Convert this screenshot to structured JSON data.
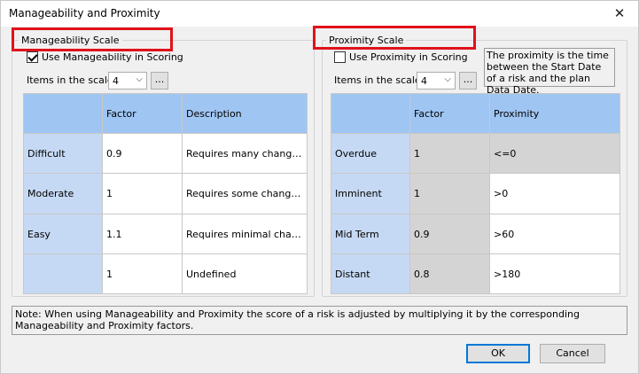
{
  "window": {
    "title": "Manageability and Proximity",
    "close_glyph": "✕"
  },
  "manageability": {
    "legend": "Manageability Scale",
    "use_label": "Use Manageability in Scoring",
    "use_checked": true,
    "items_label": "Items in the scale",
    "items_value": "4",
    "dots": "...",
    "headers": [
      "",
      "Factor",
      "Description"
    ],
    "rows": [
      {
        "name": "Difficult",
        "factor": "0.9",
        "description": "Requires many change..."
      },
      {
        "name": "Moderate",
        "factor": "1",
        "description": "Requires some changes..."
      },
      {
        "name": "Easy",
        "factor": "1.1",
        "description": "Requires minimal chan..."
      },
      {
        "name": "",
        "factor": "1",
        "description": "Undefined"
      }
    ]
  },
  "proximity": {
    "legend": "Proximity Scale",
    "use_label": "Use Proximity in Scoring",
    "use_checked": false,
    "items_label": "Items in the scale",
    "items_value": "4",
    "dots": "...",
    "info": "The proximity is the time between the Start Date of a risk and the plan Data Date.",
    "headers": [
      "",
      "Factor",
      "Proximity"
    ],
    "rows": [
      {
        "name": "Overdue",
        "factor": "1",
        "proximity": "<=0"
      },
      {
        "name": "Imminent",
        "factor": "1",
        "proximity": ">0"
      },
      {
        "name": "Mid Term",
        "factor": "0.9",
        "proximity": ">60"
      },
      {
        "name": "Distant",
        "factor": "0.8",
        "proximity": ">180"
      }
    ]
  },
  "note": "Note: When using Manageability and Proximity the score of a risk is adjusted by multiplying it by the corresponding Manageability and Proximity factors.",
  "buttons": {
    "ok": "OK",
    "cancel": "Cancel"
  },
  "colors": {
    "highlight": "#e0121a",
    "header": "#9fc5f3",
    "row_header": "#c6d9f4",
    "disabled_cell": "#d4d4d4"
  }
}
